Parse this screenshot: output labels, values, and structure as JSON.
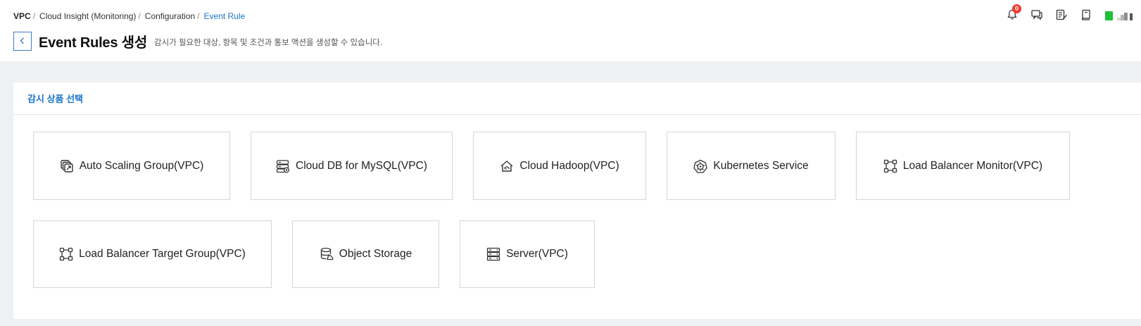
{
  "breadcrumb": {
    "items": [
      "VPC",
      "Cloud Insight (Monitoring)",
      "Configuration"
    ],
    "current": "Event Rule",
    "separator": "/"
  },
  "header": {
    "title": "Event Rules 생성",
    "description": "감시가 필요한 대상, 항목 및 조건과 통보 액션을 생성할 수 있습니다."
  },
  "toolbar": {
    "notification_count": "0",
    "icons": [
      "bell-icon",
      "chat-icon",
      "edit-note-icon",
      "book-icon"
    ]
  },
  "section": {
    "title": "감시 상품 선택"
  },
  "products": [
    {
      "label": "Auto Scaling Group(VPC)",
      "icon": "auto-scaling-icon"
    },
    {
      "label": "Cloud DB for MySQL(VPC)",
      "icon": "database-icon"
    },
    {
      "label": "Cloud Hadoop(VPC)",
      "icon": "hadoop-icon"
    },
    {
      "label": "Kubernetes Service",
      "icon": "kubernetes-icon"
    },
    {
      "label": "Load Balancer Monitor(VPC)",
      "icon": "load-balancer-icon"
    },
    {
      "label": "Load Balancer Target Group(VPC)",
      "icon": "load-balancer-icon"
    },
    {
      "label": "Object Storage",
      "icon": "object-storage-icon"
    },
    {
      "label": "Server(VPC)",
      "icon": "server-icon"
    }
  ],
  "colors": {
    "accent": "#1a73c9",
    "badge": "#ee3a2e",
    "background": "#eef0f3",
    "card_border": "#d3d6db",
    "avatar_green": "#1fc03a"
  }
}
